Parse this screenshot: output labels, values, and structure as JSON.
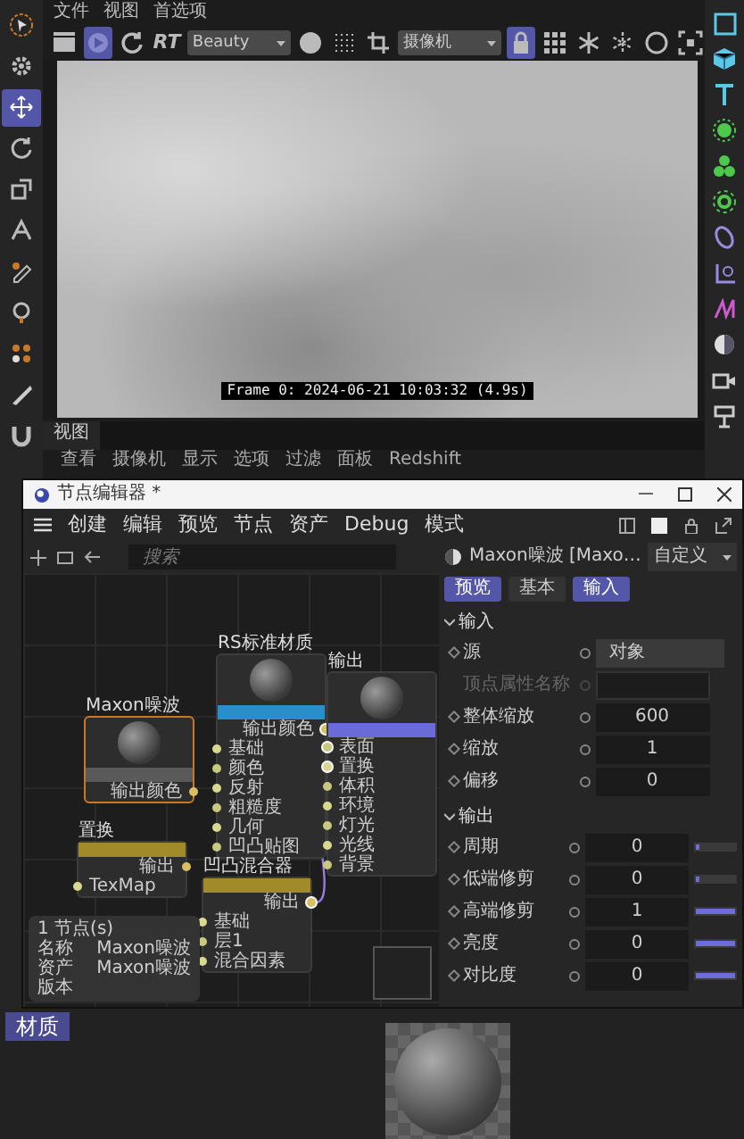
{
  "top_menu": [
    "文件",
    "视图",
    "首选项"
  ],
  "left_toolbar": [
    {
      "selected": false
    },
    {
      "selected": false
    },
    {
      "selected": true
    },
    {
      "selected": false
    },
    {
      "selected": false
    },
    {
      "selected": false
    },
    {
      "selected": false
    },
    {
      "selected": false
    },
    {
      "selected": false
    },
    {
      "selected": false
    },
    {
      "selected": false
    }
  ],
  "viewport_toolbar": [
    {
      "kind": "icon",
      "selected": false
    },
    {
      "kind": "icon",
      "selected": true
    },
    {
      "kind": "icon",
      "selected": false
    },
    {
      "kind": "text",
      "label": "RT",
      "selected": false
    },
    {
      "kind": "dropdown",
      "value": "Beauty",
      "selected": false
    },
    {
      "kind": "icon",
      "selected": false
    },
    {
      "kind": "icon",
      "selected": false
    },
    {
      "kind": "icon",
      "selected": false
    },
    {
      "kind": "dropdown",
      "value": "摄像机",
      "selected": false
    },
    {
      "kind": "icon",
      "selected": true
    },
    {
      "kind": "icon",
      "selected": false
    },
    {
      "kind": "icon",
      "selected": false
    },
    {
      "kind": "icon",
      "selected": false
    },
    {
      "kind": "icon",
      "selected": false
    },
    {
      "kind": "icon",
      "selected": false
    }
  ],
  "viewport": {
    "overlay_text": "Frame 0: 2024-06-21 10:03:32 (4.9s)"
  },
  "view_tab": "视图",
  "view_menu": [
    "查看",
    "摄像机",
    "显示",
    "选项",
    "过滤",
    "面板",
    "Redshift"
  ],
  "node_editor": {
    "title": "节点编辑器 *",
    "menu": [
      "创建",
      "编辑",
      "预览",
      "节点",
      "资产",
      "Debug",
      "模式"
    ],
    "search": {
      "placeholder": "搜索"
    },
    "nodes": [
      {
        "title": "RS标准材质",
        "kind": "preview",
        "color": "#2a8fc8",
        "selected": false,
        "ports": [
          {
            "label": "输出颜色",
            "kind": "output",
            "connected": true
          },
          {
            "label": "基础",
            "kind": "input",
            "connected": false
          },
          {
            "label": "颜色",
            "kind": "input",
            "connected": false
          },
          {
            "label": "反射",
            "kind": "input",
            "connected": false
          },
          {
            "label": "粗糙度",
            "kind": "input",
            "connected": false
          },
          {
            "label": "几何",
            "kind": "input",
            "connected": false
          },
          {
            "label": "凹凸贴图",
            "kind": "input",
            "connected": false
          }
        ]
      },
      {
        "title": "输出",
        "kind": "preview",
        "color": "#6a6ad8",
        "selected": false,
        "ports": [
          {
            "label": "表面",
            "kind": "input",
            "connected": true
          },
          {
            "label": "置换",
            "kind": "input",
            "connected": true
          },
          {
            "label": "体积",
            "kind": "input",
            "connected": false
          },
          {
            "label": "环境",
            "kind": "input",
            "connected": false
          },
          {
            "label": "灯光",
            "kind": "input",
            "connected": false
          },
          {
            "label": "光线",
            "kind": "input",
            "connected": false
          },
          {
            "label": "背景",
            "kind": "input",
            "connected": false
          }
        ]
      },
      {
        "title": "Maxon噪波",
        "kind": "preview",
        "color": "#5a5a5a",
        "selected": true,
        "ports": [
          {
            "label": "输出颜色",
            "kind": "output",
            "connected": false
          }
        ]
      },
      {
        "title": "置换",
        "kind": "plain",
        "color": "#a08a2a",
        "selected": false,
        "ports": [
          {
            "label": "输出",
            "kind": "output",
            "connected": false
          },
          {
            "label": "TexMap",
            "kind": "input",
            "connected": false
          }
        ]
      },
      {
        "title": "凹凸混合器",
        "kind": "plain",
        "color": "#a08a2a",
        "selected": false,
        "ports": [
          {
            "label": "输出",
            "kind": "output",
            "connected": true
          },
          {
            "label": "基础",
            "kind": "input",
            "connected": false
          },
          {
            "label": "层1",
            "kind": "input",
            "connected": false
          },
          {
            "label": "混合因素",
            "kind": "input",
            "connected": false
          }
        ]
      }
    ],
    "info": {
      "count": "1 节点(s)",
      "rows": [
        {
          "label": "名称",
          "value": "Maxon噪波"
        },
        {
          "label": "资产",
          "value": "Maxon噪波"
        },
        {
          "label": "版本"
        }
      ]
    }
  },
  "properties": {
    "header": "Maxon噪波 [Maxo…",
    "preset": "自定义",
    "tabs": [
      {
        "label": "预览",
        "selected": true
      },
      {
        "label": "基本",
        "selected": false
      },
      {
        "label": "输入",
        "selected": true
      }
    ],
    "groups": [
      {
        "title": "输入",
        "expanded": true,
        "rows": [
          {
            "label": "源",
            "kind": "dropdown",
            "value": "对象",
            "disabled": false
          },
          {
            "label": "顶点属性名称",
            "kind": "text",
            "disabled": true
          },
          {
            "label": "整体缩放",
            "kind": "number",
            "value": "600",
            "disabled": false
          },
          {
            "label": "缩放",
            "kind": "number",
            "value": "1",
            "disabled": false
          },
          {
            "label": "偏移",
            "kind": "number",
            "value": "0",
            "disabled": false
          }
        ]
      },
      {
        "title": "输出",
        "expanded": true,
        "rows": [
          {
            "label": "周期",
            "kind": "slider",
            "value": "0",
            "level": 0,
            "disabled": false
          },
          {
            "label": "低端修剪",
            "kind": "slider",
            "value": "0",
            "level": 0,
            "disabled": false
          },
          {
            "label": "高端修剪",
            "kind": "slider",
            "value": "1",
            "level": 1,
            "disabled": false
          },
          {
            "label": "亮度",
            "kind": "slider",
            "value": "0",
            "level": 1,
            "disabled": false
          },
          {
            "label": "对比度",
            "kind": "slider",
            "value": "0",
            "level": 1,
            "disabled": false
          }
        ]
      }
    ]
  },
  "material_panel": {
    "tab": "材质"
  }
}
